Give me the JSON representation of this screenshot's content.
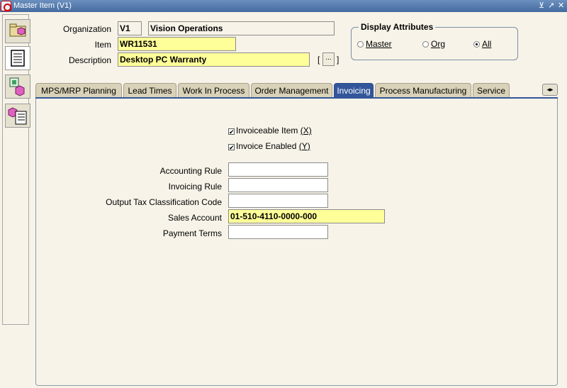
{
  "window": {
    "title": "Master Item (V1)",
    "controls": [
      "⊻",
      "↗",
      "✕"
    ]
  },
  "side_toolbar": {
    "items": [
      "Organization Assignment",
      "Attributes",
      "Categories",
      "Catalog"
    ]
  },
  "header": {
    "organization_label": "Organization",
    "organization_code": "V1",
    "organization_name": "Vision Operations",
    "item_label": "Item",
    "item_value": "WR11531",
    "description_label": "Description",
    "description_value": "Desktop PC Warranty",
    "bracket_open": "[",
    "bracket_close": "]",
    "more_button": "..."
  },
  "display_attributes": {
    "title": "Display Attributes",
    "options": [
      {
        "label": "Master",
        "mnemonic": "M",
        "selected": false
      },
      {
        "label": "Org",
        "mnemonic": "O",
        "selected": false
      },
      {
        "label": "All",
        "mnemonic": "A",
        "selected": true
      }
    ]
  },
  "tabs": [
    {
      "label": "MPS/MRP Planning",
      "active": false
    },
    {
      "label": "Lead Times",
      "active": false
    },
    {
      "label": "Work In Process",
      "active": false
    },
    {
      "label": "Order Management",
      "active": false
    },
    {
      "label": "Invoicing",
      "active": true
    },
    {
      "label": "Process Manufacturing",
      "active": false
    },
    {
      "label": "Service",
      "active": false
    }
  ],
  "tab_scroll": "◂▸",
  "invoicing": {
    "invoiceable_item": {
      "label": "Invoiceable Item",
      "shortcut": "(X)",
      "checked": true
    },
    "invoice_enabled": {
      "label": "Invoice Enabled",
      "shortcut": "(Y)",
      "checked": true
    },
    "accounting_rule_label": "Accounting Rule",
    "accounting_rule_value": "",
    "invoicing_rule_label": "Invoicing Rule",
    "invoicing_rule_value": "",
    "output_tax_label": "Output Tax Classification Code",
    "output_tax_value": "",
    "sales_account_label": "Sales Account",
    "sales_account_value": "01-510-4110-0000-000",
    "payment_terms_label": "Payment Terms",
    "payment_terms_value": ""
  },
  "colors": {
    "required_field": "#ffff99",
    "active_tab": "#33569b",
    "titlebar": "#456b9f"
  }
}
